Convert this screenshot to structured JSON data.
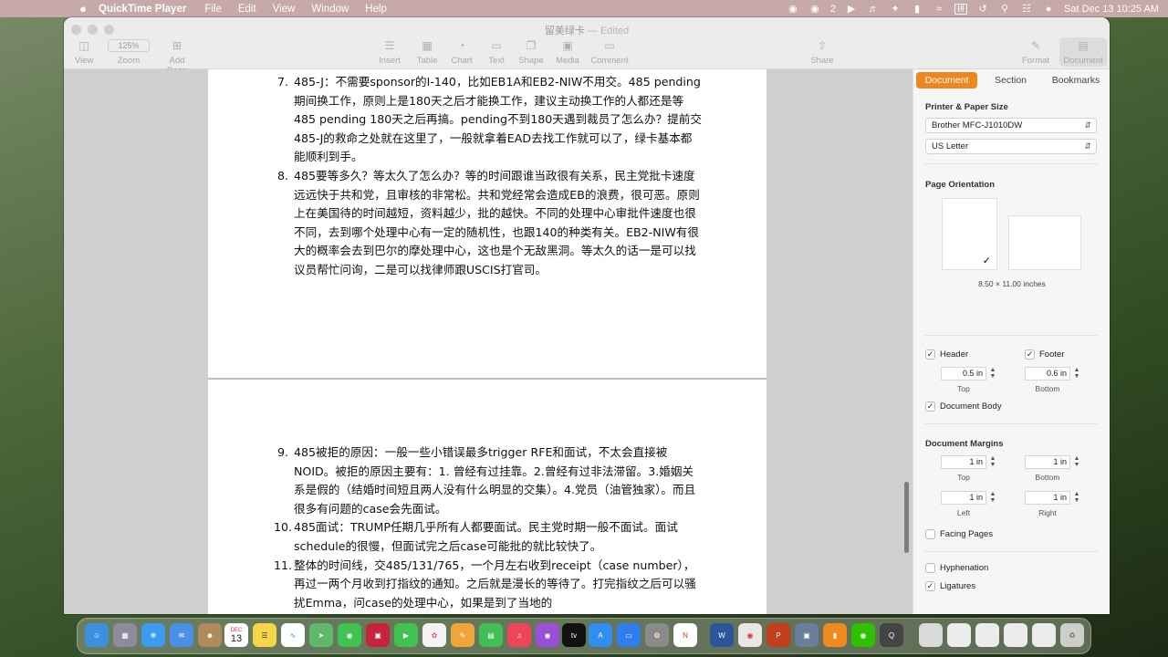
{
  "menubar": {
    "apple": "",
    "app_name": "QuickTime Player",
    "items": [
      "File",
      "Edit",
      "View",
      "Window",
      "Help"
    ],
    "wechat_badge": "2",
    "datetime": "Sat Dec 13  10:25 AM"
  },
  "window": {
    "title": "留美绿卡",
    "status": "— Edited"
  },
  "toolbar": {
    "view": "View",
    "zoom_value": "125%",
    "zoom": "Zoom",
    "add_page": "Add Page",
    "insert": "Insert",
    "table": "Table",
    "chart": "Chart",
    "text": "Text",
    "shape": "Shape",
    "media": "Media",
    "comment": "Comment",
    "share": "Share",
    "format": "Format",
    "document": "Document"
  },
  "document": {
    "items_page1": [
      {
        "num": "7.",
        "text": "485-J：不需要sponsor的I-140，比如EB1A和EB2-NIW不用交。485 pending期间换工作，原则上是180天之后才能换工作，建议主动换工作的人都还是等485 pending 180天之后再搞。pending不到180天遇到裁员了怎么办？提前交485-J的救命之处就在这里了，一般就拿着EAD去找工作就可以了，绿卡基本都能顺利到手。"
      },
      {
        "num": "8.",
        "text": "485要等多久？等太久了怎么办？等的时间跟谁当政很有关系，民主党批卡速度远远快于共和党，且审核的非常松。共和党经常会造成EB的浪费，很可恶。原则上在美国待的时间越短，资料越少，批的越快。不同的处理中心审批件速度也很不同，去到哪个处理中心有一定的随机性，也跟140的种类有关。EB2-NIW有很大的概率会去到巴尔的摩处理中心，这也是个无敌黑洞。等太久的话一是可以找议员帮忙问询，二是可以找律师跟USCIS打官司。"
      }
    ],
    "items_page2": [
      {
        "num": "9.",
        "text": "485被拒的原因：一般一些小错误最多trigger RFE和面试，不太会直接被NOID。被拒的原因主要有：1. 曾经有过挂靠。2.曾经有过非法滞留。3.婚姻关系是假的（结婚时间短且两人没有什么明显的交集）。4.党员（油管独家）。而且很多有问题的case会先面试。"
      },
      {
        "num": "10.",
        "text": "485面试：TRUMP任期几乎所有人都要面试。民主党时期一般不面试。面试schedule的很慢，但面试完之后case可能批的就比较快了。"
      },
      {
        "num": "11.",
        "text": "整体的时间线，交485/131/765，一个月左右收到receipt（case number），再过一两个月收到打指纹的通知。之后就是漫长的等待了。打完指纹之后可以骚扰Emma，问case的处理中心，如果是到了当地的"
      }
    ]
  },
  "sidebar": {
    "tabs": [
      "Document",
      "Section",
      "Bookmarks"
    ],
    "printer_heading": "Printer & Paper Size",
    "printer": "Brother MFC-J1010DW",
    "paper": "US Letter",
    "orientation_heading": "Page Orientation",
    "paper_dims": "8.50 × 11.00 inches",
    "header_label": "Header",
    "footer_label": "Footer",
    "header_value": "0.5 in",
    "footer_value": "0.6 in",
    "top_label": "Top",
    "bottom_label": "Bottom",
    "document_body": "Document Body",
    "margins_heading": "Document Margins",
    "margin_top": "1 in",
    "margin_bottom": "1 in",
    "margin_left": "1 in",
    "margin_right": "1 in",
    "left_label": "Left",
    "right_label": "Right",
    "facing_pages": "Facing Pages",
    "hyphenation": "Hyphenation",
    "ligatures": "Ligatures"
  },
  "dock": {
    "calendar_month": "DEC",
    "calendar_day": "13"
  }
}
